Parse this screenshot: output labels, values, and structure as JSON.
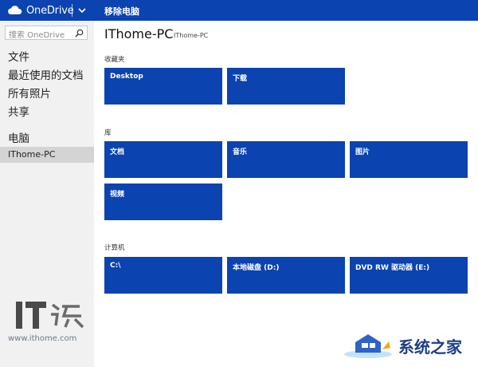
{
  "app": {
    "name": "OneDrive"
  },
  "header": {
    "title": "移除电脑"
  },
  "sidebar": {
    "search_placeholder": "搜索 OneDrive",
    "items": [
      "文件",
      "最近使用的文档",
      "所有照片",
      "共享"
    ],
    "section": "电脑",
    "selected": "IThome-PC"
  },
  "main": {
    "title": "IThome-PC",
    "subtitle": "IThome-PC",
    "sections": [
      {
        "label": "收藏夹",
        "tiles": [
          "Desktop",
          "下载"
        ]
      },
      {
        "label": "库",
        "tiles": [
          "文档",
          "音乐",
          "图片",
          "视频"
        ]
      },
      {
        "label": "计算机",
        "tiles": [
          "C:\\",
          "本地磁盘 (D:)",
          "DVD RW 驱动器 (E:)"
        ]
      }
    ]
  },
  "watermarks": {
    "left_logo": "IT之家",
    "left_url": "www.ithome.com",
    "right_text": "系统之家"
  },
  "colors": {
    "accent": "#0b43b0",
    "sidebar_bg": "#f1f1f1",
    "selected_bg": "#d4d4d4"
  }
}
